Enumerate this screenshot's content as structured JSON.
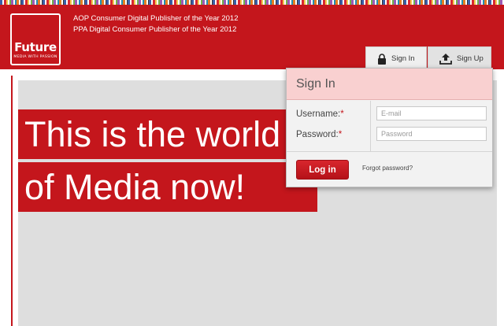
{
  "header": {
    "logo": {
      "word": "Future",
      "tagline": "MEDIA WITH PASSION"
    },
    "awards": [
      "AOP Consumer Digital Publisher of the Year 2012",
      "PPA Digital Consumer Publisher of the Year 2012"
    ],
    "tabs": [
      {
        "label": "Sign In",
        "icon": "lock-icon"
      },
      {
        "label": "Sign Up",
        "icon": "upload-icon"
      }
    ]
  },
  "hero": {
    "line1": "This is the world",
    "line2": "of Media now!"
  },
  "signin_panel": {
    "title": "Sign In",
    "username_label": "Username:",
    "password_label": "Password:",
    "required_mark": "*",
    "username_placeholder": "E-mail",
    "password_placeholder": "Password",
    "login_label": "Log in",
    "forgot_label": "Forgot password?"
  },
  "colors": {
    "brand_red": "#c4161c",
    "panel_header": "#f9d0d0",
    "content_grey": "#dedede"
  }
}
